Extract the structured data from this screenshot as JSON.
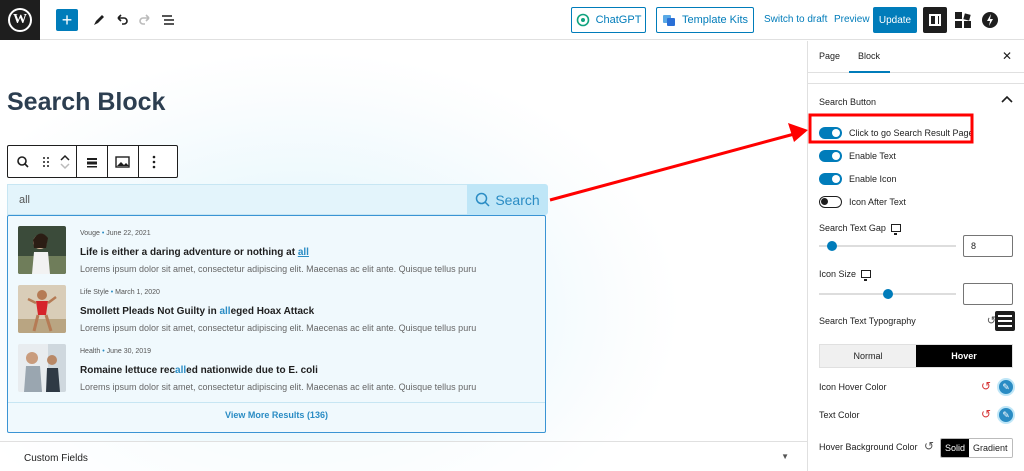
{
  "topbar": {
    "logo": "W",
    "chatgpt_label": "ChatGPT",
    "template_kits_label": "Template Kits",
    "switch_draft_label": "Switch to draft",
    "preview_label": "Preview",
    "update_label": "Update"
  },
  "editor": {
    "page_title": "Search Block",
    "search": {
      "value": "all",
      "button_label": "Search"
    },
    "results": [
      {
        "category": "Vouge",
        "date": "June 22, 2021",
        "title_before": "Life is either a daring adventure or nothing at ",
        "title_match": "all",
        "title_after": "",
        "excerpt": "Lorems ipsum dolor sit amet, consectetur adipiscing elit. Maecenas ac elit ante. Quisque tellus puru"
      },
      {
        "category": "Life Style",
        "date": "March 1, 2020",
        "title_before": "Smollett Pleads Not Guilty in ",
        "title_match": "all",
        "title_after": "eged Hoax Attack",
        "excerpt": "Lorems ipsum dolor sit amet, consectetur adipiscing elit. Maecenas ac elit ante. Quisque tellus puru"
      },
      {
        "category": "Health",
        "date": "June 30, 2019",
        "title_before": "Romaine lettuce rec",
        "title_match": "all",
        "title_after": "ed nationwide due to E. coli",
        "excerpt": "Lorems ipsum dolor sit amet, consectetur adipiscing elit. Maecenas ac elit ante. Quisque tellus puru"
      }
    ],
    "view_more_label": "View More Results",
    "view_more_count": "(136)",
    "custom_fields_label": "Custom Fields"
  },
  "sidebar": {
    "tabs": [
      "Page",
      "Block"
    ],
    "active_tab": "Block",
    "section_title": "Search Button",
    "toggles": [
      {
        "label": "Click to go Search Result Page",
        "on": true
      },
      {
        "label": "Enable Text",
        "on": true
      },
      {
        "label": "Enable Icon",
        "on": true
      },
      {
        "label": "Icon After Text",
        "on": false
      }
    ],
    "search_text_gap": {
      "label": "Search Text Gap",
      "value": "8",
      "slider_percent": 6
    },
    "icon_size": {
      "label": "Icon Size",
      "value": "",
      "slider_percent": 50
    },
    "typography_label": "Search Text Typography",
    "state_tabs": {
      "normal": "Normal",
      "hover": "Hover",
      "active": "Hover"
    },
    "icon_hover_color_label": "Icon Hover Color",
    "text_color_label": "Text Color",
    "hover_bg_label": "Hover Background Color",
    "bg_modes": {
      "solid": "Solid",
      "gradient": "Gradient"
    }
  },
  "colors": {
    "accent": "#007cba",
    "annotation": "#ff0000",
    "result_highlight": "#2a8cc4"
  }
}
